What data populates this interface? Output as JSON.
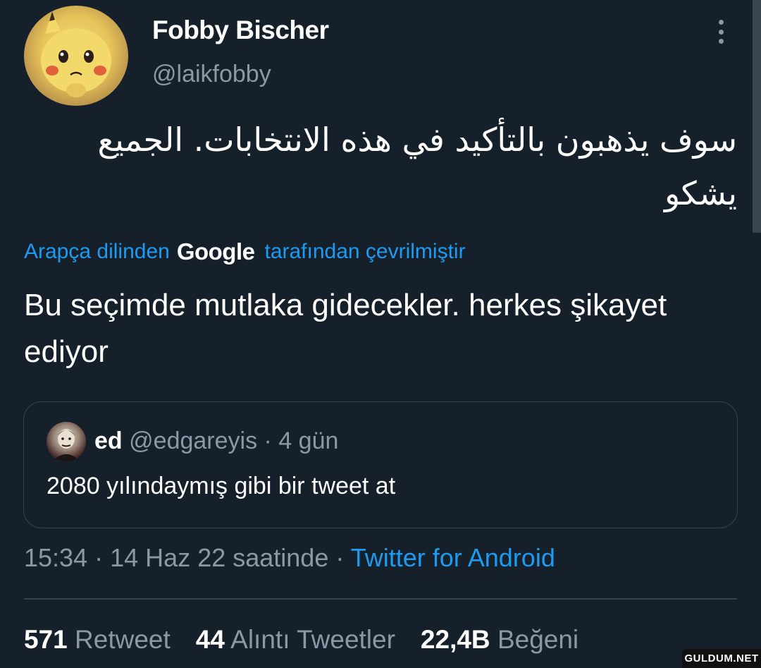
{
  "author": {
    "name": "Fobby Bischer",
    "handle": "@laikfobby"
  },
  "tweet": {
    "original_text": "سوف يذهبون بالتأكيد في هذه الانتخابات. الجميع يشكو",
    "translation": {
      "prefix": "Arapça dilinden",
      "provider": "Google",
      "suffix": "tarafından çevrilmiştir"
    },
    "translated_text": "Bu seçimde mutlaka gidecekler. herkes şikayet ediyor"
  },
  "quote": {
    "name": "ed",
    "handle": "@edgareyis",
    "separator": "·",
    "time": "4 gün",
    "text": "2080 yılındaymış gibi bir tweet at"
  },
  "meta": {
    "time": "15:34",
    "sep1": "·",
    "date": "14 Haz 22 saatinde",
    "sep2": "·",
    "source": "Twitter for Android"
  },
  "stats": {
    "retweets": {
      "count": "571",
      "label": "Retweet"
    },
    "quotes": {
      "count": "44",
      "label": "Alıntı Tweetler"
    },
    "likes": {
      "count": "22,4B",
      "label": "Beğeni"
    }
  },
  "watermark": "GULDUM.NET",
  "icons": {
    "more": "more-vertical-icon"
  },
  "colors": {
    "background": "#15202b",
    "accent": "#1d9bf0",
    "secondary_text": "#8b98a5",
    "border": "#38444d"
  }
}
